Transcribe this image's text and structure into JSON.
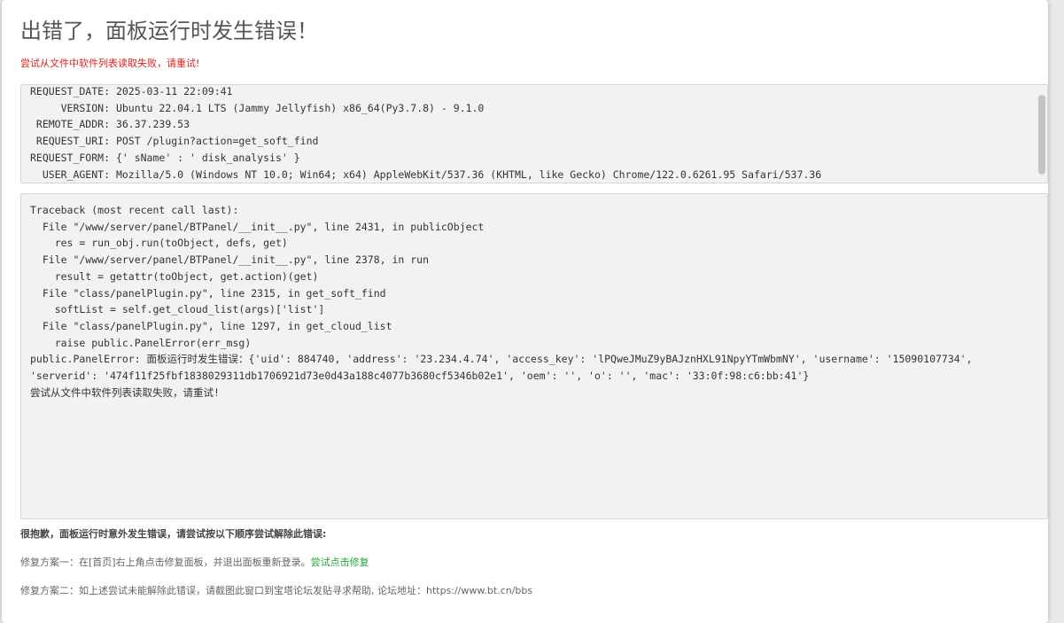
{
  "error": {
    "title": "出错了，面板运行时发生错误！",
    "subtitle": "尝试从文件中软件列表读取失败，请重试!"
  },
  "request_info": [
    {
      "key": "REQUEST_DATE",
      "value": "2025-03-11 22:09:41"
    },
    {
      "key": "VERSION",
      "value": "Ubuntu 22.04.1 LTS (Jammy Jellyfish) x86_64(Py3.7.8) - 9.1.0"
    },
    {
      "key": "REMOTE_ADDR",
      "value": "36.37.239.53"
    },
    {
      "key": "REQUEST_URI",
      "value": "POST /plugin?action=get_soft_find"
    },
    {
      "key": "REQUEST_FORM",
      "value": "{' sName' : ' disk_analysis' }"
    },
    {
      "key": "USER_AGENT",
      "value": "Mozilla/5.0 (Windows NT 10.0; Win64; x64) AppleWebKit/537.36 (KHTML, like Gecko) Chrome/122.0.6261.95 Safari/537.36"
    }
  ],
  "traceback": [
    "Traceback (most recent call last):",
    "  File \"/www/server/panel/BTPanel/__init__.py\", line 2431, in publicObject",
    "    res = run_obj.run(toObject, defs, get)",
    "  File \"/www/server/panel/BTPanel/__init__.py\", line 2378, in run",
    "    result = getattr(toObject, get.action)(get)",
    "  File \"class/panelPlugin.py\", line 2315, in get_soft_find",
    "    softList = self.get_cloud_list(args)['list']",
    "  File \"class/panelPlugin.py\", line 1297, in get_cloud_list",
    "    raise public.PanelError(err_msg)",
    "public.PanelError: 面板运行时发生错误：{'uid': 884740, 'address': '23.234.4.74', 'access_key': 'lPQweJMuZ9yBAJznHXL91NpyYTmWbmNY', 'username': '15090107734',",
    "'serverid': '474f11f25fbf1838029311db1706921d73e0d43a188c4077b3680cf5346b02e1', 'oem': '', 'o': '', 'mac': '33:0f:98:c6:bb:41'}",
    "尝试从文件中软件列表读取失败，请重试!"
  ],
  "help": {
    "heading": "很抱歉，面板运行时意外发生错误，请尝试按以下顺序尝试解除此错误:",
    "option1_text": "修复方案一：在[首页]右上角点击修复面板，并退出面板重新登录。",
    "option1_link": "尝试点击修复",
    "option2_text": "修复方案二：如上述尝试未能解除此错误，请截图此窗口到宝塔论坛发贴寻求帮助, 论坛地址：https://www.bt.cn/bbs"
  },
  "colors": {
    "error_red": "#e02020",
    "link_green": "#20a53a"
  }
}
